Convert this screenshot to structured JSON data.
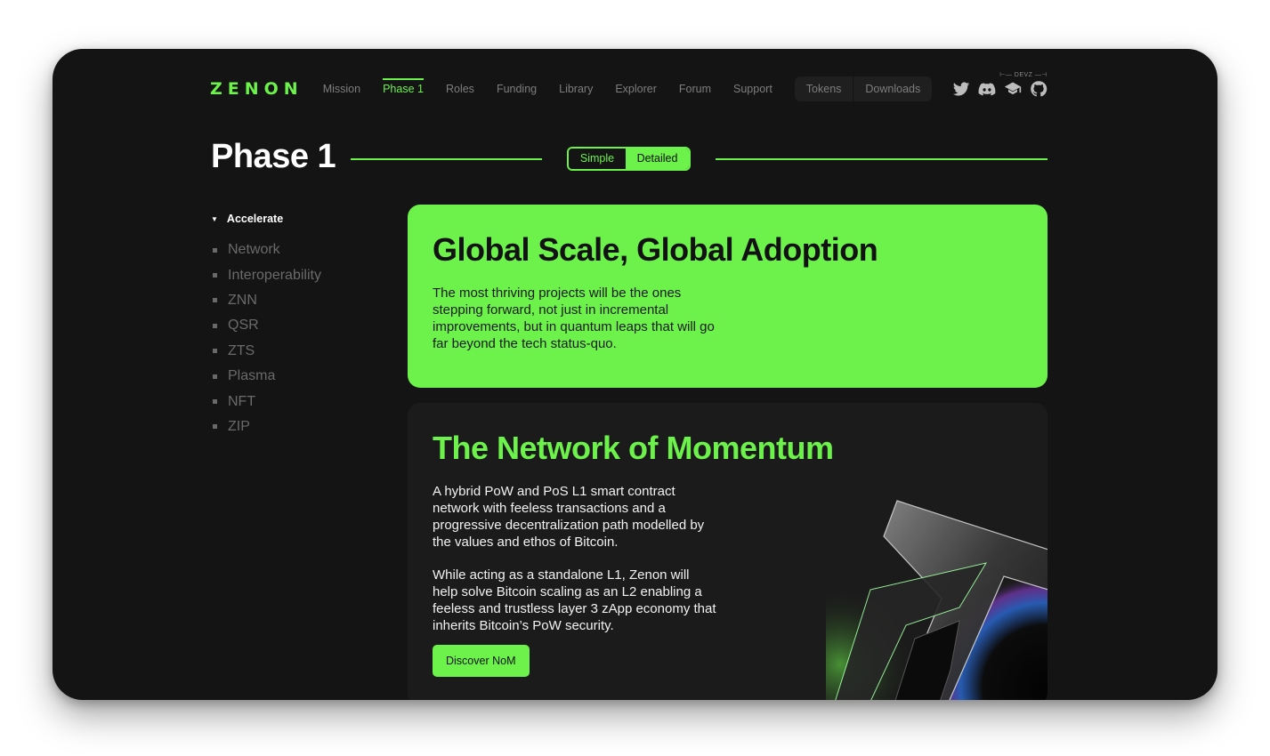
{
  "nav": {
    "logo": "ZENON",
    "links": [
      "Mission",
      "Phase 1",
      "Roles",
      "Funding",
      "Library",
      "Explorer",
      "Forum",
      "Support"
    ],
    "active": "Phase 1",
    "pill": [
      "Tokens",
      "Downloads"
    ],
    "devz_label": "DEVZ",
    "socials": [
      "twitter-icon",
      "discord-icon",
      "devz-icon",
      "github-icon"
    ]
  },
  "header": {
    "title": "Phase 1",
    "toggle": {
      "simple": "Simple",
      "detailed": "Detailed",
      "selected": "Detailed"
    }
  },
  "sidebar": {
    "section": "Accelerate",
    "items": [
      "Network",
      "Interoperability",
      "ZNN",
      "QSR",
      "ZTS",
      "Plasma",
      "NFT",
      "ZIP"
    ]
  },
  "cards": {
    "global": {
      "title": "Global Scale, Global Adoption",
      "body": "The most thriving projects will be the ones stepping forward, not just in incremental improvements, but in quantum leaps that will go far beyond the tech status-quo."
    },
    "network": {
      "title": "The Network of Momentum",
      "body1": "A hybrid PoW and PoS L1 smart contract network with feeless transactions and a progressive decentralization path modelled by the values and ethos of Bitcoin.",
      "body2": "While acting as a standalone L1, Zenon will help solve Bitcoin scaling as an L2 enabling a feeless and trustless layer 3 zApp economy that inherits Bitcoin’s PoW security.",
      "button": "Discover NoM"
    }
  },
  "colors": {
    "accent": "#6cf24a",
    "background": "#141414",
    "card_dark": "#1b1b1b"
  }
}
